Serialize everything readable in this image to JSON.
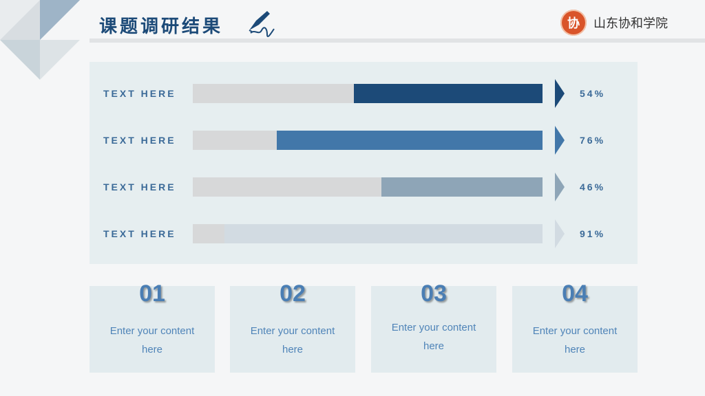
{
  "slide": {
    "title": "课题调研结果",
    "brand": {
      "logo_text": "协",
      "name": "山东协和学院"
    }
  },
  "bars": [
    {
      "label": "TEXT HERE",
      "value": 54,
      "percent_text": "54%",
      "color": "#1c4a78"
    },
    {
      "label": "TEXT HERE",
      "value": 76,
      "percent_text": "76%",
      "color": "#4277a9"
    },
    {
      "label": "TEXT HERE",
      "value": 46,
      "percent_text": "46%",
      "color": "#8ea5b7"
    },
    {
      "label": "TEXT HERE",
      "value": 91,
      "percent_text": "91%",
      "color": "#d2dbe2"
    }
  ],
  "cards": [
    {
      "number": "01",
      "text_line1": "Enter your content",
      "text_line2": "here"
    },
    {
      "number": "02",
      "text_line1": "Enter your content",
      "text_line2": "here"
    },
    {
      "number": "03",
      "text_line1": "Enter your content",
      "text_line2": "here"
    },
    {
      "number": "04",
      "text_line1": "Enter your content",
      "text_line2": "here"
    }
  ],
  "colors": {
    "title": "#1c4a78",
    "panel": "#e6eef0",
    "card": "#e2ebee",
    "accent_text": "#3b6a98"
  }
}
